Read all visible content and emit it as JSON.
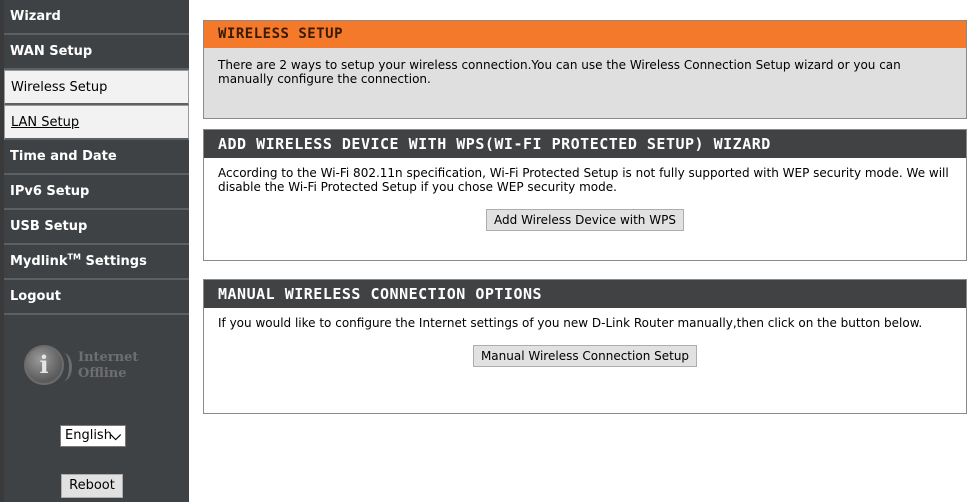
{
  "sidebar": {
    "items": [
      {
        "label": "Wizard"
      },
      {
        "label": "WAN Setup"
      },
      {
        "label": "Wireless Setup"
      },
      {
        "label": "LAN Setup"
      },
      {
        "label": "Time and Date"
      },
      {
        "label": "IPv6 Setup"
      },
      {
        "label": "USB Setup"
      },
      {
        "label": "Mydlink",
        "sup": "TM",
        "suffix": " Settings"
      },
      {
        "label": "Logout"
      }
    ],
    "status": {
      "line1": "Internet",
      "line2": "Offline",
      "icon": "info-icon"
    },
    "language": {
      "selected": "English",
      "chevron": "✓"
    },
    "reboot_label": "Reboot"
  },
  "wireless_setup": {
    "title": "WIRELESS SETUP",
    "text": "There are 2 ways to setup your wireless connection.You can use the Wireless Connection Setup wizard or you can manually configure the connection."
  },
  "wps": {
    "title": "ADD WIRELESS DEVICE WITH WPS(WI-FI PROTECTED SETUP) WIZARD",
    "text": "According to the Wi-Fi 802.11n specification, Wi-Fi Protected Setup is not fully supported with WEP security mode. We will disable the Wi-Fi Protected Setup if you chose WEP security mode.",
    "button_label": "Add Wireless Device with WPS"
  },
  "manual": {
    "title": "MANUAL WIRELESS CONNECTION OPTIONS",
    "text": "If you would like to configure the Internet settings of you new D-Link Router manually,then click on the button below.",
    "button_label": "Manual Wireless Connection Setup"
  },
  "colors": {
    "sidebar_bg": "#3f4244",
    "accent_orange": "#f4792a",
    "section_header": "#414244"
  }
}
